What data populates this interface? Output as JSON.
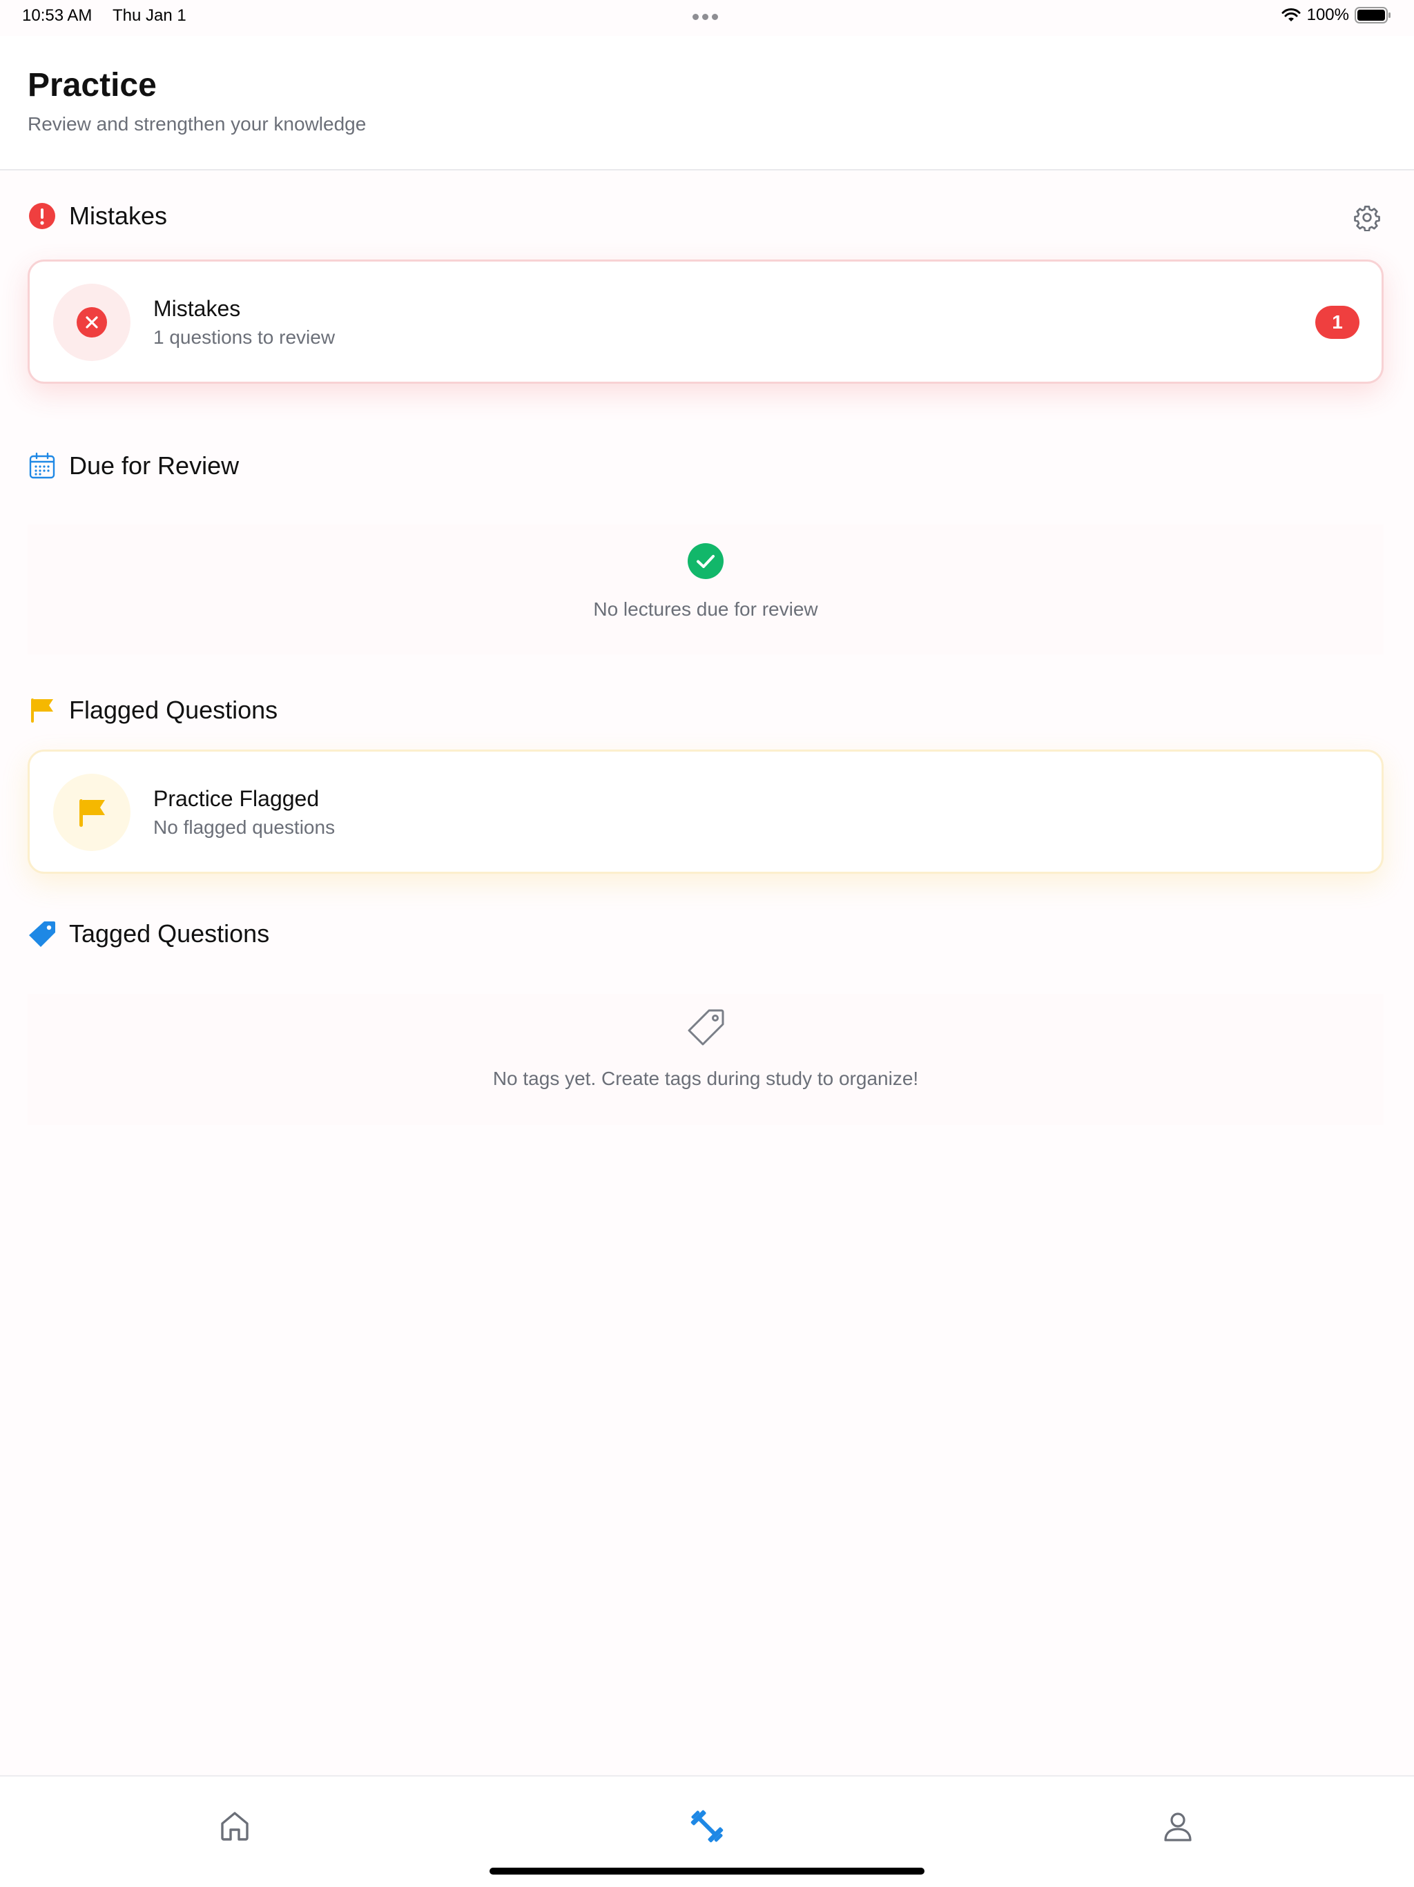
{
  "status_bar": {
    "time": "10:53 AM",
    "date": "Thu Jan 1",
    "battery": "100%"
  },
  "header": {
    "title": "Practice",
    "subtitle": "Review and strengthen your knowledge"
  },
  "sections": {
    "mistakes": {
      "title": "Mistakes",
      "card": {
        "title": "Mistakes",
        "subtitle": "1 questions to review",
        "badge": "1"
      }
    },
    "due_review": {
      "title": "Due for Review",
      "empty_text": "No lectures due for review"
    },
    "flagged": {
      "title": "Flagged Questions",
      "card": {
        "title": "Practice Flagged",
        "subtitle": "No flagged questions"
      }
    },
    "tagged": {
      "title": "Tagged Questions",
      "empty_text": "No tags yet. Create tags during study to organize!"
    }
  },
  "tabs": [
    {
      "name": "home",
      "icon": "home-icon",
      "active": false
    },
    {
      "name": "practice",
      "icon": "dumbbell-icon",
      "active": true
    },
    {
      "name": "profile",
      "icon": "person-icon",
      "active": false
    }
  ],
  "colors": {
    "accent": "#1e88e5",
    "danger": "#ef3f3f",
    "success": "#12b76a",
    "warning": "#f5b800"
  }
}
